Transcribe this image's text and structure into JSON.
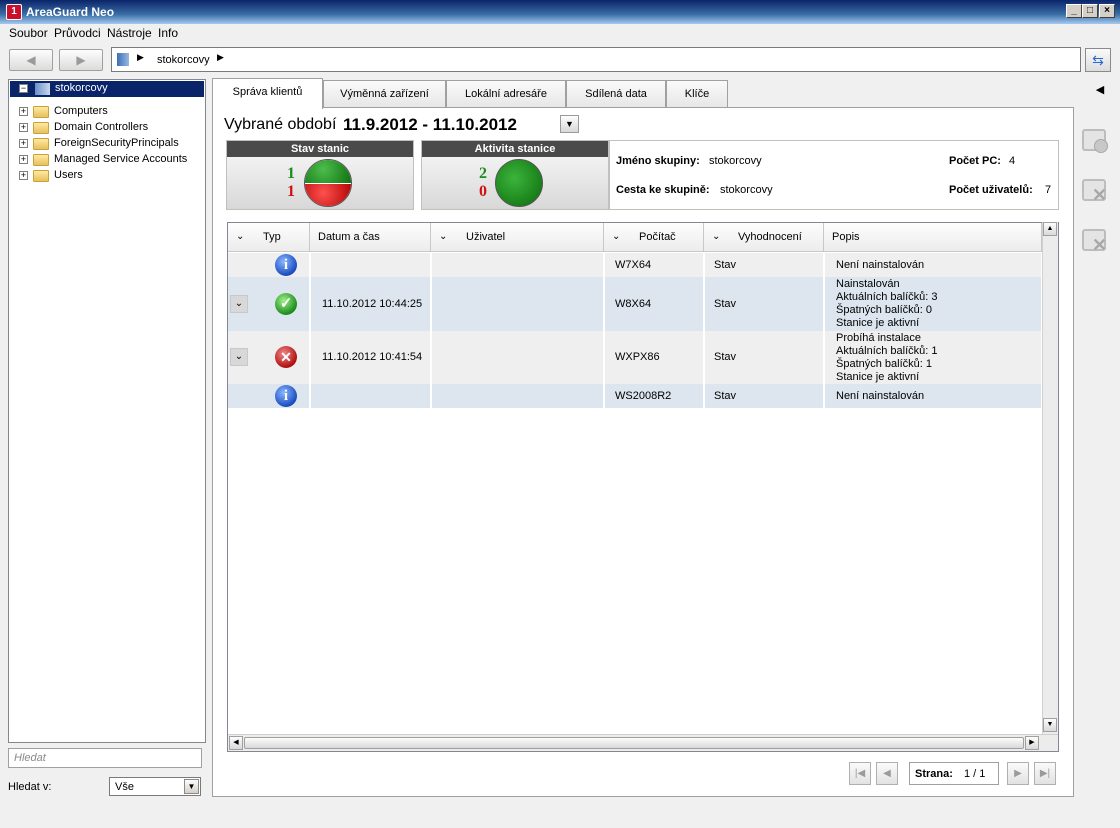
{
  "window": {
    "title": "AreaGuard Neo"
  },
  "menu": [
    "Soubor",
    "Průvodci",
    "Nástroje",
    "Info"
  ],
  "address": {
    "path": "stokorcovy"
  },
  "tree": {
    "root": "stokorcovy",
    "items": [
      "Computers",
      "Domain Controllers",
      "ForeignSecurityPrincipals",
      "Managed Service Accounts",
      "Users"
    ]
  },
  "search": {
    "placeholder": "Hledat",
    "in_label": "Hledat v:",
    "in_value": "Vše"
  },
  "tabs": [
    "Správa klientů",
    "Výměnná zařízení",
    "Lokální adresáře",
    "Sdílená data",
    "Klíče"
  ],
  "period": {
    "label": "Vybrané období",
    "value": "11.9.2012 - 11.10.2012"
  },
  "status_panels": {
    "stav": {
      "title": "Stav stanic",
      "green": "1",
      "red": "1"
    },
    "aktivita": {
      "title": "Aktivita stanice",
      "green": "2",
      "red": "0"
    }
  },
  "group_info": {
    "name_label": "Jméno skupiny:",
    "name": "stokorcovy",
    "path_label": "Cesta ke skupině:",
    "path": "stokorcovy",
    "pc_label": "Počet PC:",
    "pc": "4",
    "users_label": "Počet uživatelů:",
    "users": "7"
  },
  "grid": {
    "headers": {
      "typ": "Typ",
      "datum": "Datum a čas",
      "uzivatel": "Uživatel",
      "pocitac": "Počítač",
      "vyhodnoceni": "Vyhodnocení",
      "popis": "Popis"
    },
    "rows": [
      {
        "type": "info",
        "datum": "",
        "uzivatel": "",
        "pocitac": "W7X64",
        "vyhodnoceni": "Stav",
        "popis": [
          "Není nainstalován"
        ]
      },
      {
        "type": "ok",
        "datum": "11.10.2012 10:44:25",
        "uzivatel": "",
        "pocitac": "W8X64",
        "vyhodnoceni": "Stav",
        "popis": [
          "Nainstalován",
          "Aktuálních balíčků: 3",
          "Špatných balíčků: 0",
          "Stanice je aktivní"
        ]
      },
      {
        "type": "error",
        "datum": "11.10.2012 10:41:54",
        "uzivatel": "",
        "pocitac": "WXPX86",
        "vyhodnoceni": "Stav",
        "popis": [
          "Probíhá instalace",
          "Aktuálních balíčků: 1",
          "Špatných balíčků: 1",
          "Stanice je aktivní"
        ]
      },
      {
        "type": "info",
        "datum": "",
        "uzivatel": "",
        "pocitac": "WS2008R2",
        "vyhodnoceni": "Stav",
        "popis": [
          "Není nainstalován"
        ]
      }
    ]
  },
  "pager": {
    "label": "Strana:",
    "value": "1 / 1"
  },
  "colors": {
    "selection": "#0a246a",
    "green": "#1c8c1c",
    "red": "#d01010",
    "row_alt": "#dde6ef"
  }
}
